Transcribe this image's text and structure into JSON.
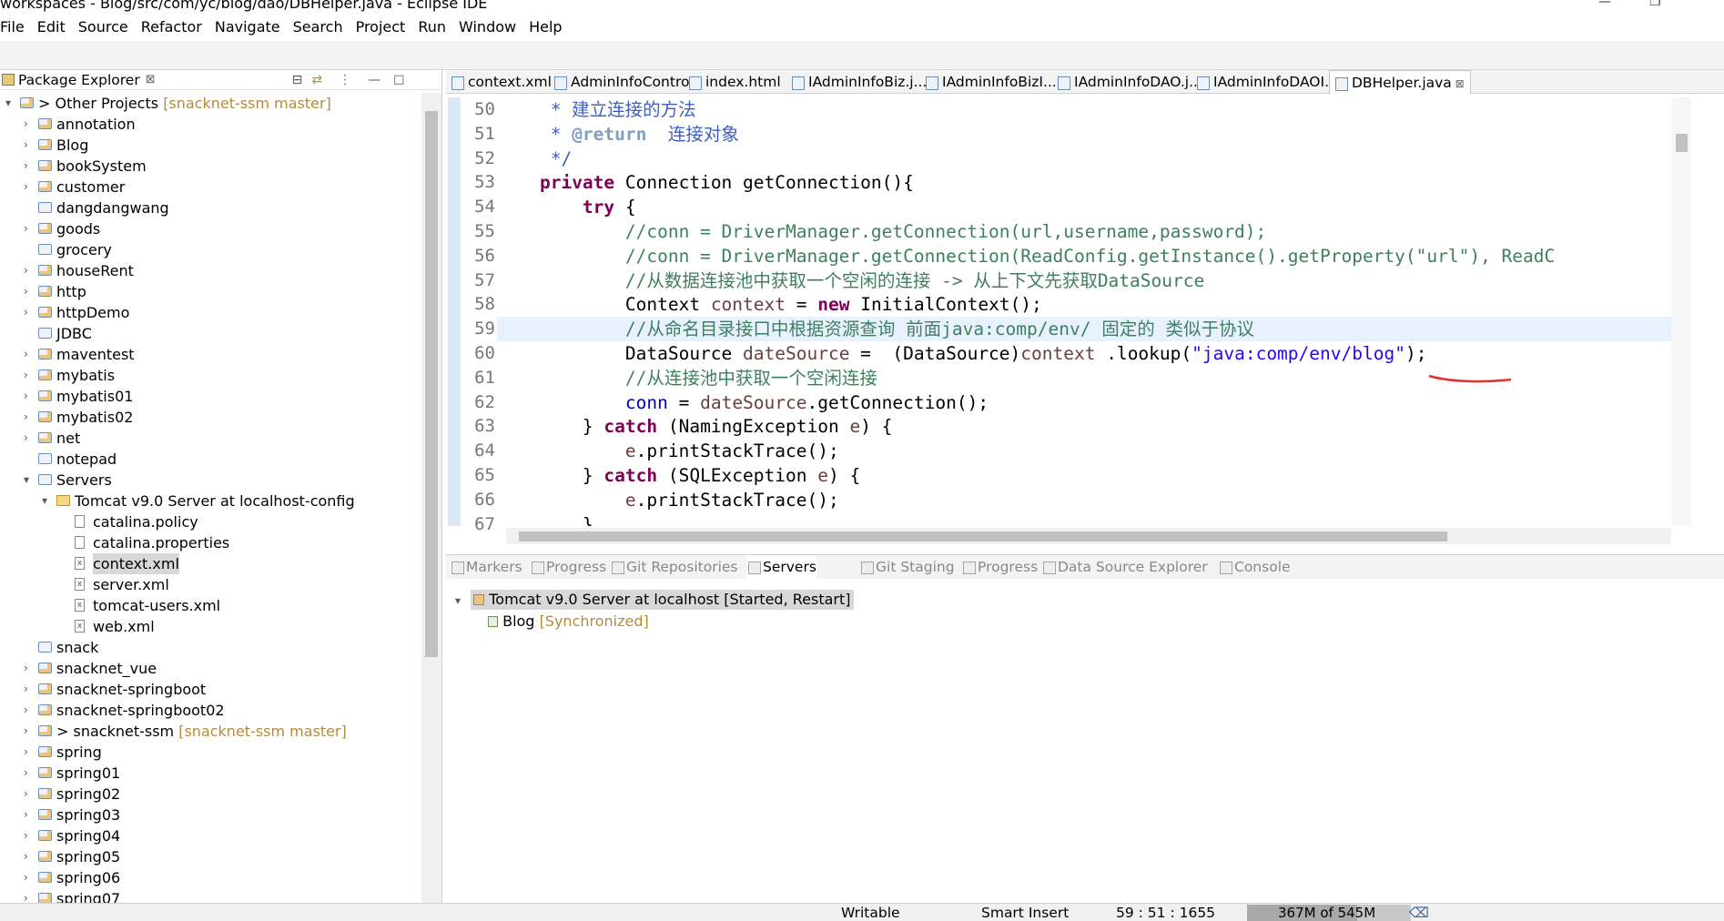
{
  "window": {
    "title": "workspaces - Blog/src/com/yc/blog/dao/DBHelper.java - Eclipse IDE",
    "min": "—",
    "max": "❐"
  },
  "menu": [
    "File",
    "Edit",
    "Source",
    "Refactor",
    "Navigate",
    "Search",
    "Project",
    "Run",
    "Window",
    "Help"
  ],
  "package_explorer": {
    "title": "Package Explorer",
    "tree": [
      {
        "t": "▾",
        "d": 0,
        "icon": "projg",
        "label": "> Other Projects",
        "git": "[snacknet-ssm master]"
      },
      {
        "t": "›",
        "d": 1,
        "icon": "projg",
        "label": "annotation"
      },
      {
        "t": "›",
        "d": 1,
        "icon": "projg",
        "label": "Blog"
      },
      {
        "t": "›",
        "d": 1,
        "icon": "projg",
        "label": "bookSystem"
      },
      {
        "t": "›",
        "d": 1,
        "icon": "projg",
        "label": "customer"
      },
      {
        "t": "",
        "d": 1,
        "icon": "proj",
        "label": "dangdangwang"
      },
      {
        "t": "›",
        "d": 1,
        "icon": "projg",
        "label": "goods"
      },
      {
        "t": "",
        "d": 1,
        "icon": "proj",
        "label": "grocery"
      },
      {
        "t": "›",
        "d": 1,
        "icon": "projg",
        "label": "houseRent"
      },
      {
        "t": "›",
        "d": 1,
        "icon": "projg",
        "label": "http"
      },
      {
        "t": "›",
        "d": 1,
        "icon": "projg",
        "label": "httpDemo"
      },
      {
        "t": "",
        "d": 1,
        "icon": "proj",
        "label": "JDBC"
      },
      {
        "t": "›",
        "d": 1,
        "icon": "projg",
        "label": "maventest"
      },
      {
        "t": "›",
        "d": 1,
        "icon": "projg",
        "label": "mybatis"
      },
      {
        "t": "›",
        "d": 1,
        "icon": "projg",
        "label": "mybatis01"
      },
      {
        "t": "›",
        "d": 1,
        "icon": "projg",
        "label": "mybatis02"
      },
      {
        "t": "›",
        "d": 1,
        "icon": "projg",
        "label": "net"
      },
      {
        "t": "",
        "d": 1,
        "icon": "proj",
        "label": "notepad"
      },
      {
        "t": "▾",
        "d": 1,
        "icon": "proj",
        "label": "Servers"
      },
      {
        "t": "▾",
        "d": 2,
        "icon": "folder",
        "label": "Tomcat v9.0 Server at localhost-config"
      },
      {
        "t": "",
        "d": 3,
        "icon": "file",
        "label": "catalina.policy"
      },
      {
        "t": "",
        "d": 3,
        "icon": "file",
        "label": "catalina.properties"
      },
      {
        "t": "",
        "d": 3,
        "icon": "xml",
        "label": "context.xml",
        "selected": true
      },
      {
        "t": "",
        "d": 3,
        "icon": "xml",
        "label": "server.xml"
      },
      {
        "t": "",
        "d": 3,
        "icon": "xml",
        "label": "tomcat-users.xml"
      },
      {
        "t": "",
        "d": 3,
        "icon": "xml",
        "label": "web.xml"
      },
      {
        "t": "",
        "d": 1,
        "icon": "proj",
        "label": "snack"
      },
      {
        "t": "›",
        "d": 1,
        "icon": "projg",
        "label": "snacknet_vue"
      },
      {
        "t": "›",
        "d": 1,
        "icon": "projg",
        "label": "snacknet-springboot"
      },
      {
        "t": "›",
        "d": 1,
        "icon": "projg",
        "label": "snacknet-springboot02"
      },
      {
        "t": "›",
        "d": 1,
        "icon": "projg",
        "label": "> snacknet-ssm",
        "git": "[snacknet-ssm master]"
      },
      {
        "t": "›",
        "d": 1,
        "icon": "projg",
        "label": "spring"
      },
      {
        "t": "›",
        "d": 1,
        "icon": "projg",
        "label": "spring01"
      },
      {
        "t": "›",
        "d": 1,
        "icon": "projg",
        "label": "spring02"
      },
      {
        "t": "›",
        "d": 1,
        "icon": "projg",
        "label": "spring03"
      },
      {
        "t": "›",
        "d": 1,
        "icon": "projg",
        "label": "spring04"
      },
      {
        "t": "›",
        "d": 1,
        "icon": "projg",
        "label": "spring05"
      },
      {
        "t": "›",
        "d": 1,
        "icon": "projg",
        "label": "spring06"
      },
      {
        "t": "›",
        "d": 1,
        "icon": "projg",
        "label": "spring07"
      }
    ]
  },
  "editor": {
    "tabs": [
      {
        "label": "context.xml"
      },
      {
        "label": "AdminInfoContro..."
      },
      {
        "label": "index.html"
      },
      {
        "label": "IAdminInfoBiz.j..."
      },
      {
        "label": "IAdminInfoBizI..."
      },
      {
        "label": "IAdminInfoDAO.j..."
      },
      {
        "label": "IAdminInfoDAOI..."
      },
      {
        "label": "DBHelper.java",
        "active": true
      }
    ],
    "lines": [
      {
        "n": "50",
        "cur": false,
        "s": [
          [
            "jd",
            "     * 建立连接的方法"
          ]
        ]
      },
      {
        "n": "51",
        "cur": false,
        "s": [
          [
            "jd",
            "     * "
          ],
          [
            "jtag",
            "@return"
          ],
          [
            "jd",
            "  连接对象"
          ]
        ]
      },
      {
        "n": "52",
        "cur": false,
        "s": [
          [
            "jd",
            "     */"
          ]
        ]
      },
      {
        "n": "53",
        "cur": false,
        "s": [
          [
            "",
            "    "
          ],
          [
            "kw",
            "private"
          ],
          [
            "",
            " Connection getConnection(){"
          ]
        ]
      },
      {
        "n": "54",
        "cur": false,
        "s": [
          [
            "",
            "        "
          ],
          [
            "kw",
            "try"
          ],
          [
            "",
            " {"
          ]
        ]
      },
      {
        "n": "55",
        "cur": false,
        "s": [
          [
            "cm",
            "            //conn = DriverManager.getConnection(url,username,password);"
          ]
        ]
      },
      {
        "n": "56",
        "cur": false,
        "s": [
          [
            "cm",
            "            //conn = DriverManager.getConnection(ReadConfig.getInstance().getProperty(\"url\"), ReadC"
          ]
        ]
      },
      {
        "n": "57",
        "cur": false,
        "s": [
          [
            "cm",
            "            //从数据连接池中获取一个空闲的连接 -> 从上下文先获取DataSource"
          ]
        ]
      },
      {
        "n": "58",
        "cur": false,
        "s": [
          [
            "",
            "            Context "
          ],
          [
            "lv",
            "context"
          ],
          [
            "",
            " = "
          ],
          [
            "kw",
            "new"
          ],
          [
            "",
            " InitialContext();"
          ]
        ]
      },
      {
        "n": "59",
        "cur": true,
        "s": [
          [
            "cm",
            "            //从命名目录接口中根据资源查询 前面java:comp/env/ 固定的 类似于协议"
          ]
        ]
      },
      {
        "n": "60",
        "cur": false,
        "s": [
          [
            "",
            "            DataSource "
          ],
          [
            "lv",
            "dateSource"
          ],
          [
            "",
            " =  (DataSource)"
          ],
          [
            "lv",
            "context"
          ],
          [
            "",
            " .lookup("
          ],
          [
            "st",
            "\"java:comp/env/blog\""
          ],
          [
            "",
            ");"
          ]
        ]
      },
      {
        "n": "61",
        "cur": false,
        "s": [
          [
            "cm",
            "            //从连接池中获取一个空闲连接"
          ]
        ]
      },
      {
        "n": "62",
        "cur": false,
        "s": [
          [
            "",
            "            "
          ],
          [
            "fld",
            "conn"
          ],
          [
            "",
            " = "
          ],
          [
            "lv",
            "dateSource"
          ],
          [
            "",
            ".getConnection();"
          ]
        ]
      },
      {
        "n": "63",
        "cur": false,
        "s": [
          [
            "",
            "        } "
          ],
          [
            "kw",
            "catch"
          ],
          [
            "",
            " (NamingException "
          ],
          [
            "lv",
            "e"
          ],
          [
            "",
            ") {"
          ]
        ]
      },
      {
        "n": "64",
        "cur": false,
        "s": [
          [
            "",
            "            "
          ],
          [
            "lv",
            "e"
          ],
          [
            "",
            ".printStackTrace();"
          ]
        ]
      },
      {
        "n": "65",
        "cur": false,
        "s": [
          [
            "",
            "        } "
          ],
          [
            "kw",
            "catch"
          ],
          [
            "",
            " (SQLException "
          ],
          [
            "lv",
            "e"
          ],
          [
            "",
            ") {"
          ]
        ]
      },
      {
        "n": "66",
        "cur": false,
        "s": [
          [
            "",
            "            "
          ],
          [
            "lv",
            "e"
          ],
          [
            "",
            ".printStackTrace();"
          ]
        ]
      },
      {
        "n": "67",
        "cur": false,
        "s": [
          [
            "",
            "        }"
          ]
        ]
      }
    ]
  },
  "bottom": {
    "tabs": [
      {
        "label": "Markers"
      },
      {
        "label": "Progress"
      },
      {
        "label": "Git Repositories"
      },
      {
        "label": "Servers",
        "active": true
      },
      {
        "label": "Git Staging"
      },
      {
        "label": "Progress"
      },
      {
        "label": "Data Source Explorer"
      },
      {
        "label": "Console"
      }
    ],
    "server": {
      "name": "Tomcat v9.0 Server at localhost",
      "state": "[Started, Restart]"
    },
    "module": {
      "name": "Blog",
      "state": "[Synchronized]"
    }
  },
  "status": {
    "writable": "Writable",
    "insert": "Smart Insert",
    "position": "59 : 51 : 1655",
    "heap": "367M of 545M",
    "heap_fraction": 0.67
  },
  "colors": {
    "annotation": "#e0322f",
    "selection": "#d8d8d8",
    "current_line": "#e8f2fe"
  }
}
